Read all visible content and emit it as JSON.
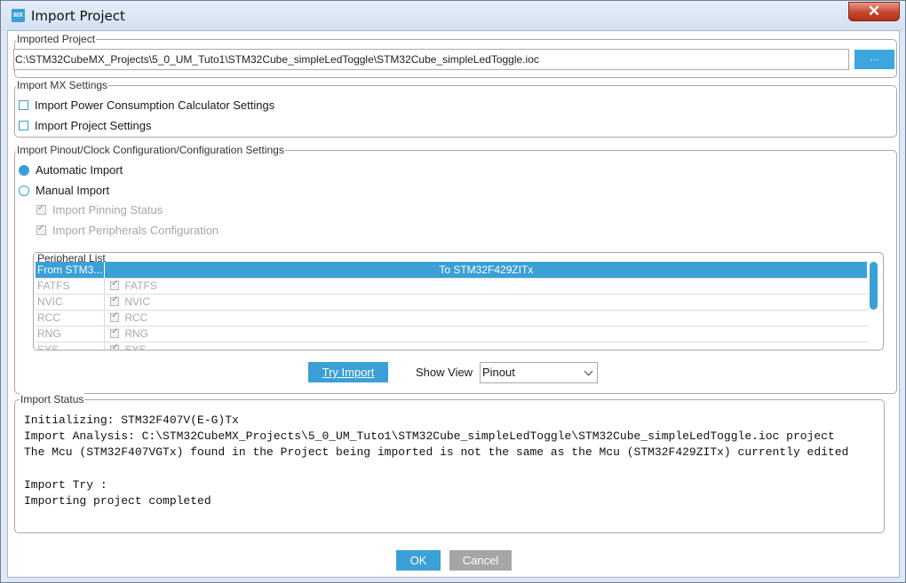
{
  "window": {
    "title": "Import Project",
    "app_icon": "MX",
    "close_glyph": "✕"
  },
  "imported_project": {
    "legend": "Imported Project",
    "path": "C:\\STM32CubeMX_Projects\\5_0_UM_Tuto1\\STM32Cube_simpleLedToggle\\STM32Cube_simpleLedToggle.ioc",
    "browse_label": "..."
  },
  "mx_settings": {
    "legend": "Import MX Settings",
    "options": [
      {
        "label": "Import Power Consumption Calculator Settings",
        "checked": false
      },
      {
        "label": "Import Project Settings",
        "checked": false
      }
    ]
  },
  "pinout": {
    "legend": "Import Pinout/Clock Configuration/Configuration Settings",
    "automatic_label": "Automatic Import",
    "manual_label": "Manual Import",
    "selected": "automatic",
    "pinning_label": "Import Pinning Status",
    "peripherals_label": "Import Peripherals Configuration",
    "peripheral_list": {
      "legend": "Peripheral List",
      "header_from": "From STM3...",
      "header_to": "To STM32F429ZITx",
      "rows": [
        {
          "from": "FATFS",
          "to": "FATFS"
        },
        {
          "from": "NVIC",
          "to": "NVIC"
        },
        {
          "from": "RCC",
          "to": "RCC"
        },
        {
          "from": "RNG",
          "to": "RNG"
        },
        {
          "from": "SYS",
          "to": "SYS"
        }
      ]
    },
    "try_import_label": "Try Import",
    "show_view_label": "Show View",
    "show_view_value": "Pinout"
  },
  "import_status": {
    "legend": "Import Status",
    "lines": [
      "Initializing: STM32F407V(E-G)Tx",
      "Import Analysis: C:\\STM32CubeMX_Projects\\5_0_UM_Tuto1\\STM32Cube_simpleLedToggle\\STM32Cube_simpleLedToggle.ioc project",
      "The Mcu (STM32F407VGTx) found in the Project being imported is not the same as the Mcu (STM32F429ZITx) currently edited",
      "",
      "Import Try :",
      "Importing project completed"
    ]
  },
  "footer": {
    "ok_label": "OK",
    "cancel_label": "Cancel"
  },
  "colors": {
    "accent": "#3aa0d6",
    "disabled_button": "#a6a6a6"
  }
}
